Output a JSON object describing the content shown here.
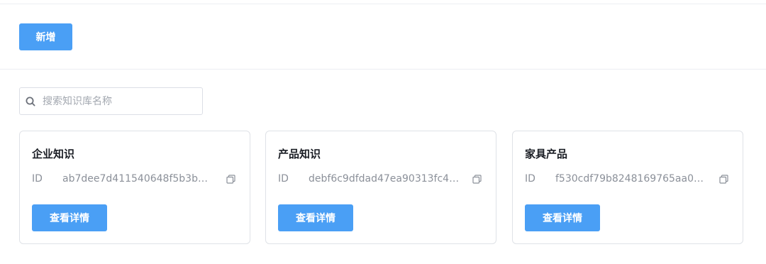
{
  "toolbar": {
    "add_label": "新增"
  },
  "search": {
    "placeholder": "搜索知识库名称",
    "value": ""
  },
  "colors": {
    "primary": "#4a9ff5",
    "border": "#dfe2e7",
    "muted_text": "#8b9099"
  },
  "cards": [
    {
      "title": "企业知识",
      "id_label": "ID",
      "id_value": "ab7dee7d411540648f5b3b8…",
      "detail_label": "查看详情"
    },
    {
      "title": "产品知识",
      "id_label": "ID",
      "id_value": "debf6c9dfdad47ea90313fc4…",
      "detail_label": "查看详情"
    },
    {
      "title": "家具产品",
      "id_label": "ID",
      "id_value": "f530cdf79b8248169765aa02…",
      "detail_label": "查看详情"
    }
  ],
  "icons": {
    "search": "search-icon",
    "copy": "copy-icon"
  }
}
